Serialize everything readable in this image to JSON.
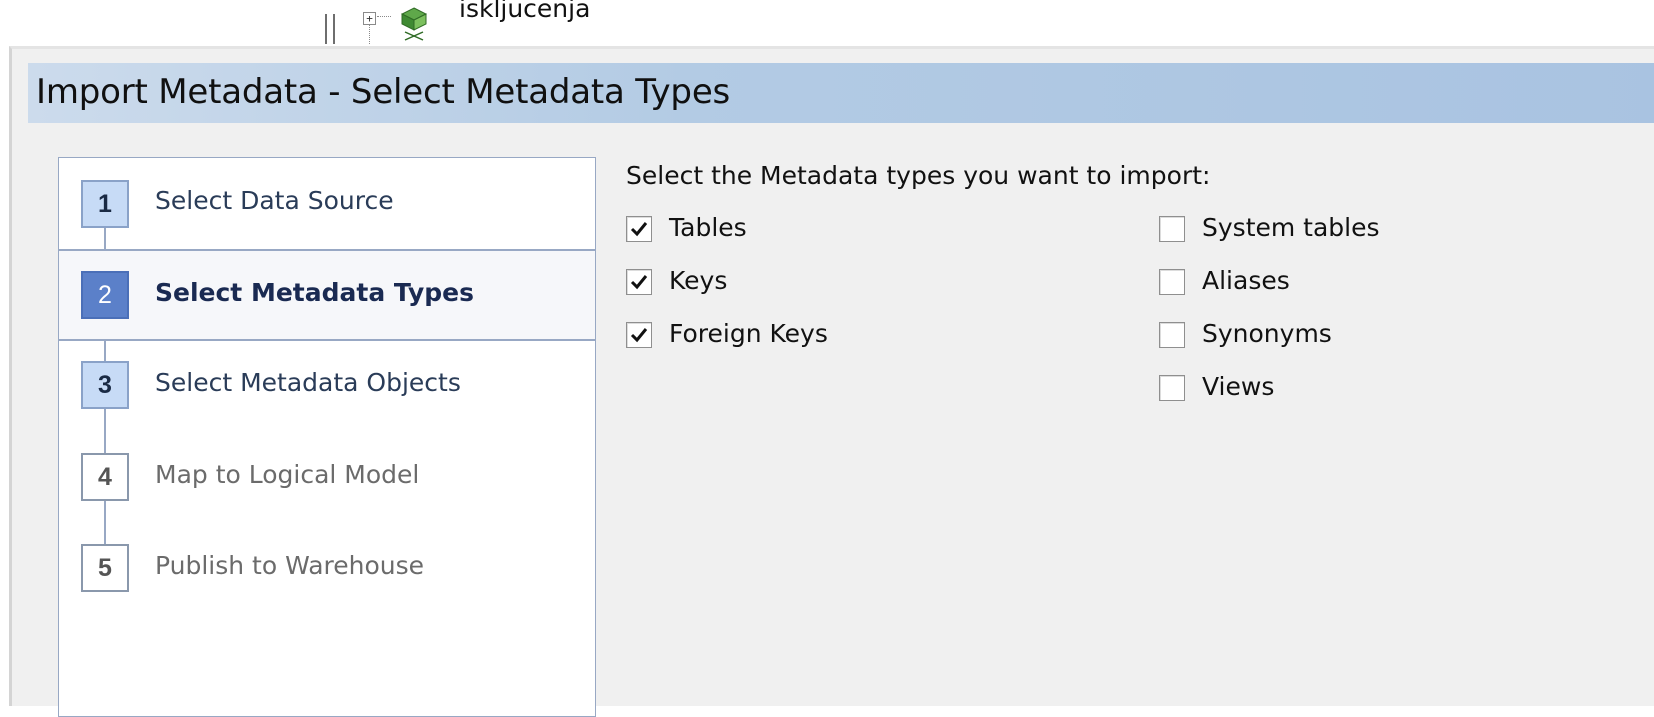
{
  "background": {
    "tree_node_label": "iskljucenja",
    "tree_expander_glyph": "+",
    "tree_node_icon": "cube-icon"
  },
  "dialog": {
    "title": "Import Metadata - Select Metadata Types",
    "title_bar_color": "#b3cbe4"
  },
  "wizard": {
    "current_step": 2,
    "steps": [
      {
        "number": "1",
        "label": "Select Data Source",
        "state": "completed"
      },
      {
        "number": "2",
        "label": "Select Metadata Types",
        "state": "current"
      },
      {
        "number": "3",
        "label": "Select Metadata Objects",
        "state": "completed"
      },
      {
        "number": "4",
        "label": "Map to Logical Model",
        "state": "pending"
      },
      {
        "number": "5",
        "label": "Publish to Warehouse",
        "state": "pending"
      }
    ],
    "colors": {
      "current": "#5b80c9",
      "completed": "#c7dbf6",
      "pending": "#ffffff"
    }
  },
  "options": {
    "instruction": "Select the Metadata types you want to import:",
    "left_column": [
      {
        "label": "Tables",
        "checked": true
      },
      {
        "label": "Keys",
        "checked": true
      },
      {
        "label": "Foreign Keys",
        "checked": true
      }
    ],
    "right_column": [
      {
        "label": "System tables",
        "checked": false
      },
      {
        "label": "Aliases",
        "checked": false
      },
      {
        "label": "Synonyms",
        "checked": false
      },
      {
        "label": "Views",
        "checked": false
      }
    ]
  }
}
